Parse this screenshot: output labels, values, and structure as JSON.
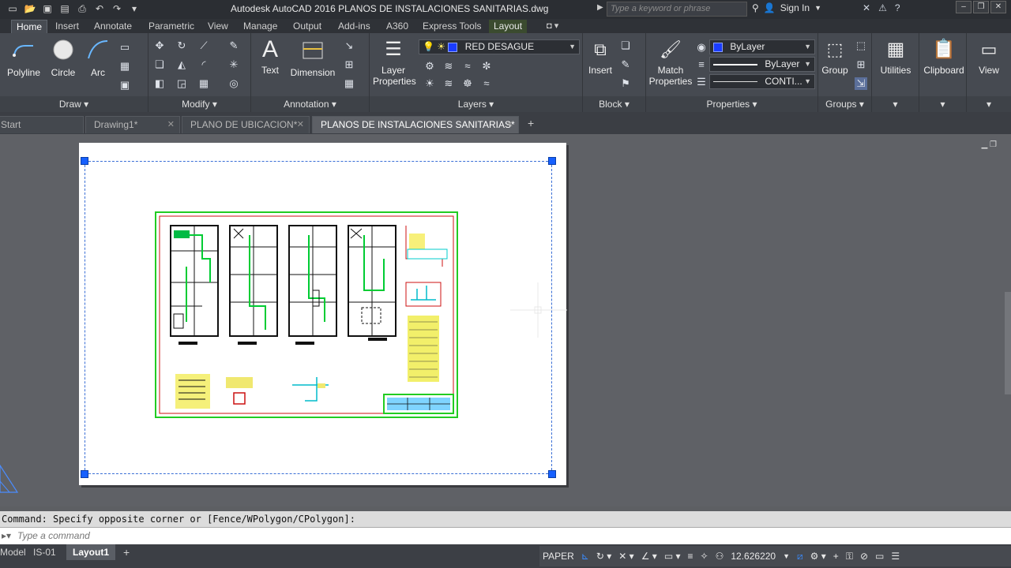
{
  "window": {
    "title": "Autodesk AutoCAD 2016    PLANOS DE INSTALACIONES SANITARIAS.dwg",
    "search_placeholder": "Type a keyword or phrase",
    "sign_in": "Sign In"
  },
  "ribbon_tabs": [
    "Home",
    "Insert",
    "Annotate",
    "Parametric",
    "View",
    "Manage",
    "Output",
    "Add-ins",
    "A360",
    "Express Tools",
    "Layout"
  ],
  "ribbon": {
    "draw": {
      "title": "Draw",
      "polyline": "Polyline",
      "circle": "Circle",
      "arc": "Arc"
    },
    "modify": {
      "title": "Modify"
    },
    "annotation": {
      "title": "Annotation",
      "text": "Text",
      "dimension": "Dimension"
    },
    "layers": {
      "title": "Layers",
      "layer_properties": "Layer Properties",
      "current_layer": "RED DESAGUE"
    },
    "block": {
      "title": "Block",
      "insert": "Insert"
    },
    "properties": {
      "title": "Properties",
      "match_properties": "Match Properties",
      "color": "ByLayer",
      "lineweight": "ByLayer",
      "linetype": "CONTI..."
    },
    "groups": {
      "title": "Groups",
      "group": "Group"
    },
    "utilities": "Utilities",
    "clipboard": "Clipboard",
    "view": "View"
  },
  "file_tabs": [
    {
      "label": "Start"
    },
    {
      "label": "Drawing1*"
    },
    {
      "label": "PLANO DE UBICACION*"
    },
    {
      "label": "PLANOS DE INSTALACIONES SANITARIAS*"
    }
  ],
  "command": {
    "history": "Command: Specify opposite corner or [Fence/WPolygon/CPolygon]:",
    "placeholder": "Type a command"
  },
  "layout_tabs": [
    "Model",
    "IS-01",
    "Layout1"
  ],
  "status": {
    "space": "PAPER",
    "scale": "12.626220"
  },
  "colors": {
    "current_layer_color": "#1a3cff",
    "viewport_border": "#3a6fd6",
    "title_block": "#00cc00",
    "sheet_frame": "#cc0000"
  }
}
